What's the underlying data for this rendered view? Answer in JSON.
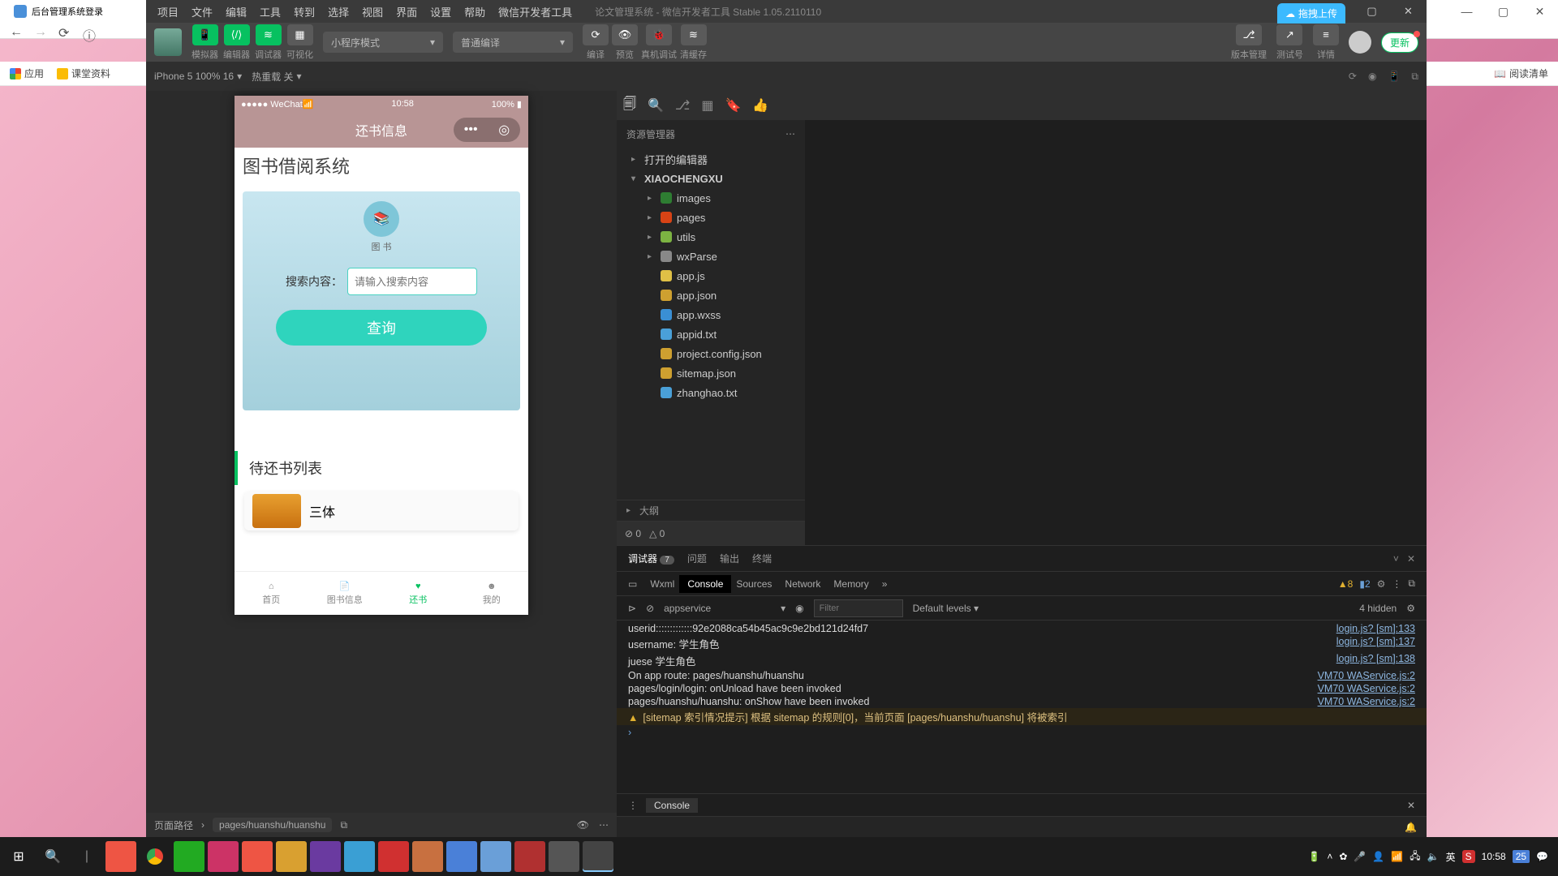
{
  "browser": {
    "tab_title": "后台管理系统登录",
    "bookmarks": {
      "apps": "应用",
      "teaching": "课堂资料"
    },
    "reading_list": "阅读清单",
    "win": {
      "min": "—",
      "max": "▢",
      "close": "✕"
    }
  },
  "ide": {
    "menus": [
      "项目",
      "文件",
      "编辑",
      "工具",
      "转到",
      "选择",
      "视图",
      "界面",
      "设置",
      "帮助",
      "微信开发者工具"
    ],
    "title": "论文管理系统 - 微信开发者工具 Stable 1.05.2110110",
    "cols": {
      "simulator": "模拟器",
      "editor": "编辑器",
      "debugger": "调试器",
      "visual": "可视化"
    },
    "toolbar": {
      "mode_select": "小程序模式",
      "build_select": "普通编译",
      "compile": "编译",
      "preview": "预览",
      "device": "真机调试",
      "clear_cache": "清缓存",
      "vcs": "版本管理",
      "test_id": "测试号",
      "details": "详情",
      "cloud_upload": "拖拽上传",
      "update": "更新"
    },
    "secondary": {
      "device": "iPhone 5 100% 16",
      "hot_reload": "热重载 关"
    },
    "status_bar": {
      "path_label": "页面路径",
      "path_value": "pages/huanshu/huanshu",
      "zero_a": "0",
      "zero_b": "0",
      "outline": "大纲"
    },
    "win": {
      "min": "—",
      "max": "▢",
      "close": "✕"
    }
  },
  "explorer": {
    "header": "资源管理器",
    "open_editors": "打开的编辑器",
    "root": "XIAOCHENGXU",
    "items": [
      {
        "name": "images",
        "type": "folder",
        "color": "#2e7d32"
      },
      {
        "name": "pages",
        "type": "folder",
        "color": "#d84315"
      },
      {
        "name": "utils",
        "type": "folder",
        "color": "#7cb342"
      },
      {
        "name": "wxParse",
        "type": "folder",
        "color": "#888"
      },
      {
        "name": "app.js",
        "type": "js",
        "color": "#dfc046"
      },
      {
        "name": "app.json",
        "type": "json",
        "color": "#cea030"
      },
      {
        "name": "app.wxss",
        "type": "wxss",
        "color": "#3a8fd4"
      },
      {
        "name": "appid.txt",
        "type": "txt",
        "color": "#4aa0d8"
      },
      {
        "name": "project.config.json",
        "type": "json",
        "color": "#cea030"
      },
      {
        "name": "sitemap.json",
        "type": "json",
        "color": "#cea030"
      },
      {
        "name": "zhanghao.txt",
        "type": "txt",
        "color": "#4aa0d8"
      }
    ]
  },
  "phone": {
    "status": {
      "carrier": "●●●●● WeChat",
      "time": "10:58",
      "battery": "100%"
    },
    "nav_title": "还书信息",
    "dims": "320px × 456px",
    "banner": "图书借阅系统",
    "logo_text": "图 书",
    "search_label": "搜索内容：",
    "search_placeholder": "请输入搜索内容",
    "query_btn": "查询",
    "list_title": "待还书列表",
    "list_item_title": "三体",
    "tabbar": [
      {
        "label": "首页",
        "active": false
      },
      {
        "label": "图书信息",
        "active": false
      },
      {
        "label": "还书",
        "active": true
      },
      {
        "label": "我的",
        "active": false
      }
    ]
  },
  "debugger": {
    "tabs": {
      "debugger": "调试器",
      "badge": "7",
      "problems": "问题",
      "output": "输出",
      "terminal": "终端"
    },
    "devtools_tabs": [
      "Wxml",
      "Console",
      "Sources",
      "Network",
      "Memory"
    ],
    "warn_count": "8",
    "info_count": "2",
    "filter_context": "appservice",
    "filter_placeholder": "Filter",
    "levels": "Default levels",
    "hidden": "4 hidden",
    "logs": [
      {
        "msg": "userid:::::::::::::92e2088ca54b45ac9c9e2bd121d24fd7",
        "src": "login.js? [sm]:133",
        "lvl": ""
      },
      {
        "msg": "username:  学生角色",
        "src": "login.js? [sm]:137",
        "lvl": ""
      },
      {
        "msg": "juese 学生角色",
        "src": "login.js? [sm]:138",
        "lvl": ""
      },
      {
        "msg": "On app route: pages/huanshu/huanshu",
        "src": "VM70 WAService.js:2",
        "lvl": ""
      },
      {
        "msg": "pages/login/login: onUnload have been invoked",
        "src": "VM70 WAService.js:2",
        "lvl": ""
      },
      {
        "msg": "pages/huanshu/huanshu: onShow have been invoked",
        "src": "VM70 WAService.js:2",
        "lvl": ""
      },
      {
        "msg": "[sitemap 索引情况提示] 根据 sitemap 的规则[0]，当前页面 [pages/huanshu/huanshu] 将被索引",
        "src": "",
        "lvl": "warn"
      }
    ],
    "console_footer": "Console"
  },
  "taskbar": {
    "time": "10:58",
    "ime": "英",
    "date_badge": "25"
  }
}
